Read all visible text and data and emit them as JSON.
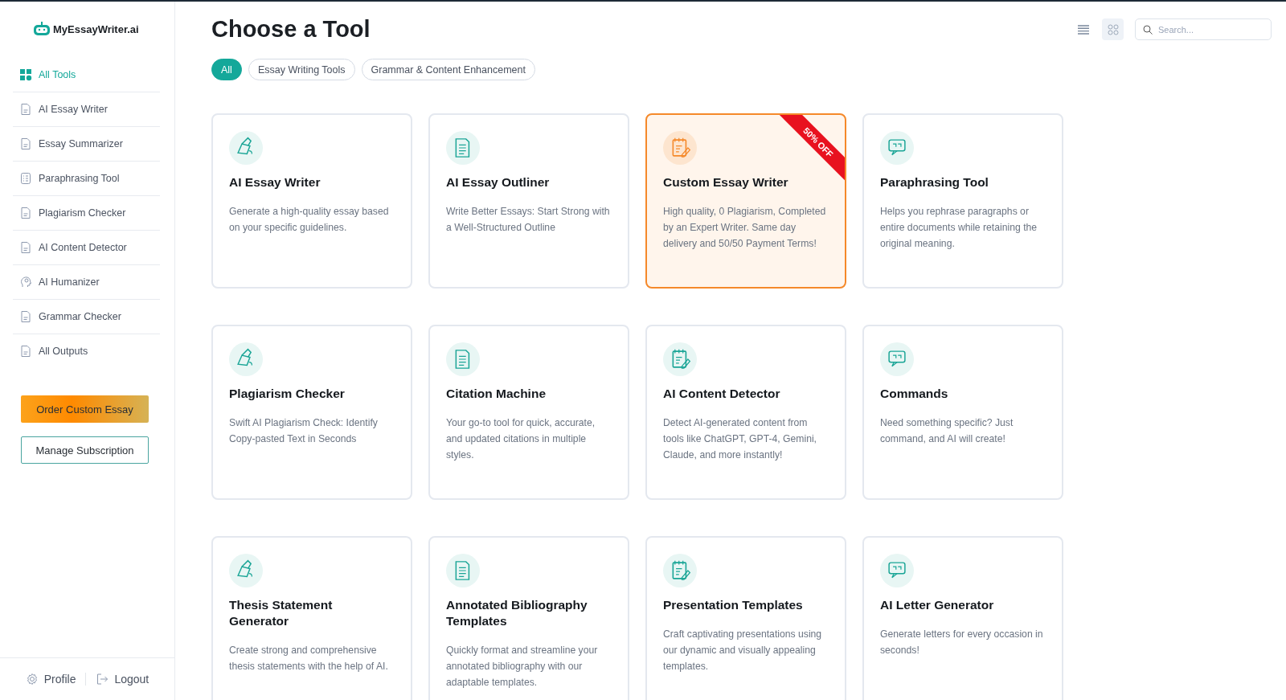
{
  "sidebar": {
    "logo": "MyEssayWriter.ai",
    "items": [
      {
        "label": "All Tools",
        "selected": true,
        "kind": "grid"
      },
      {
        "label": "AI Essay Writer",
        "selected": false,
        "kind": "doc"
      },
      {
        "label": "Essay Summarizer",
        "selected": false,
        "kind": "doc"
      },
      {
        "label": "Paraphrasing Tool",
        "selected": false,
        "kind": "list"
      },
      {
        "label": "Plagiarism Checker",
        "selected": false,
        "kind": "doc"
      },
      {
        "label": "AI Content Detector",
        "selected": false,
        "kind": "doc"
      },
      {
        "label": "AI Humanizer",
        "selected": false,
        "kind": "head"
      },
      {
        "label": "Grammar Checker",
        "selected": false,
        "kind": "doc"
      },
      {
        "label": "All Outputs",
        "selected": false,
        "kind": "doc"
      }
    ],
    "buttons": [
      {
        "label": "Order Custom Essay",
        "kind": "primary"
      },
      {
        "label": "Manage Subscription",
        "kind": "outline"
      }
    ],
    "footer": [
      {
        "label": "Profile",
        "kind": "gear"
      },
      {
        "label": "Logout",
        "kind": "logout"
      }
    ]
  },
  "header": {
    "title": "Choose a Tool",
    "view_buttons": [
      {
        "kind": "list",
        "selected": false
      },
      {
        "kind": "grid",
        "selected": true
      }
    ],
    "search": {
      "placeholder": "Search..."
    }
  },
  "filters": [
    {
      "label": "All",
      "selected": true
    },
    {
      "label": "Essay Writing Tools",
      "selected": false
    },
    {
      "label": "Grammar & Content Enhancement",
      "selected": false
    }
  ],
  "cards": [
    {
      "title": "AI Essay Writer",
      "description": "Generate a high-quality essay based on your specific guidelines.",
      "highlighted": false
    },
    {
      "title": "AI Essay Outliner",
      "description": "Write Better Essays: Start Strong with a Well-Structured Outline",
      "highlighted": false
    },
    {
      "title": "Custom Essay Writer",
      "description": "High quality, 0 Plagiarism, Completed by an Expert Writer. Same day delivery and 50/50 Payment Terms!",
      "highlighted": true,
      "ribbon": "50% OFF"
    },
    {
      "title": "Paraphrasing Tool",
      "description": "Helps you rephrase paragraphs or entire documents while retaining the original meaning.",
      "highlighted": false
    },
    {
      "title": "Plagiarism Checker",
      "description": "Swift AI Plagiarism Check: Identify Copy-pasted Text in Seconds",
      "highlighted": false
    },
    {
      "title": "Citation Machine",
      "description": "Your go-to tool for quick, accurate, and updated citations in multiple styles.",
      "highlighted": false
    },
    {
      "title": "AI Content Detector",
      "description": "Detect AI-generated content from tools like ChatGPT, GPT-4, Gemini, Claude, and more instantly!",
      "highlighted": false
    },
    {
      "title": "Commands",
      "description": "Need something specific? Just command, and AI will create!",
      "highlighted": false
    },
    {
      "title": "Thesis Statement Generator",
      "description": "Create strong and comprehensive thesis statements with the help of AI.",
      "highlighted": false
    },
    {
      "title": "Annotated Bibliography Templates",
      "description": "Quickly format and streamline your annotated bibliography with our adaptable templates.",
      "highlighted": false
    },
    {
      "title": "Presentation Templates",
      "description": "Craft captivating presentations using our dynamic and visually appealing templates.",
      "highlighted": false
    },
    {
      "title": "AI Letter Generator",
      "description": "Generate letters for every occasion in seconds!",
      "highlighted": false
    }
  ]
}
